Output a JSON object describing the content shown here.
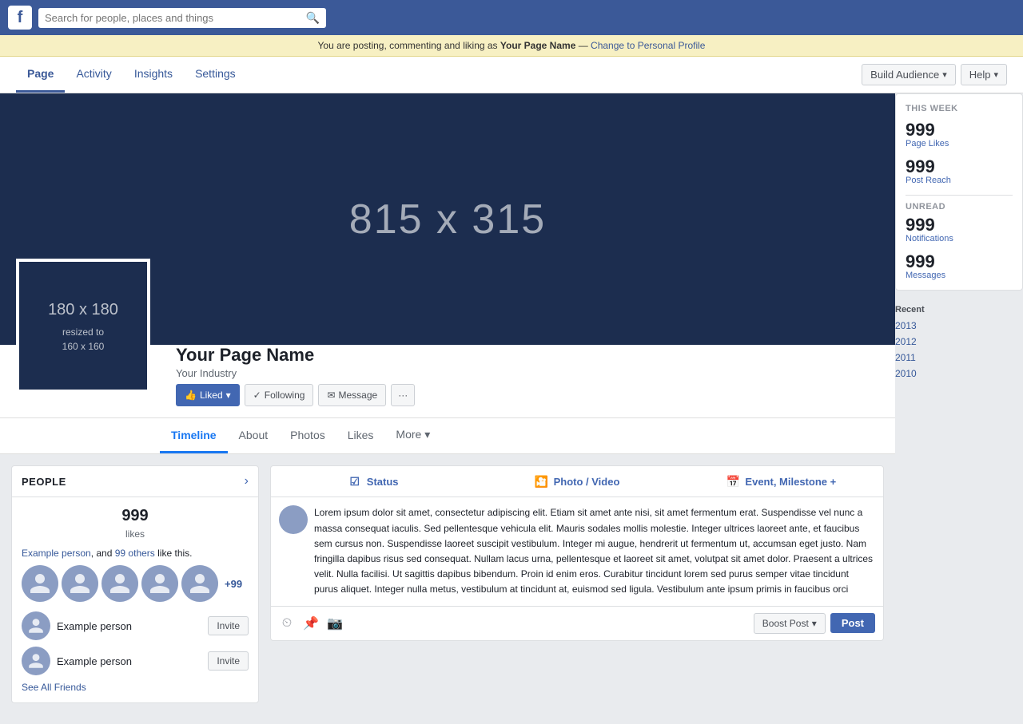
{
  "topnav": {
    "logo": "f",
    "search_placeholder": "Search for people, places and things"
  },
  "banner": {
    "text_before": "You are posting, commenting and liking as ",
    "page_name": "Your Page Name",
    "text_after": " — ",
    "link": "Change to Personal Profile"
  },
  "pagenav": {
    "tabs": [
      {
        "label": "Page",
        "active": true
      },
      {
        "label": "Activity",
        "active": false
      },
      {
        "label": "Insights",
        "active": false
      },
      {
        "label": "Settings",
        "active": false
      }
    ],
    "build_audience": "Build Audience",
    "help": "Help"
  },
  "cover": {
    "dimensions": "815 x 315"
  },
  "profile": {
    "pic_main": "180 x 180",
    "pic_sub": "resized to",
    "pic_sub2": "160 x 160",
    "name": "Your Page Name",
    "industry": "Your Industry",
    "actions": {
      "liked": "Liked",
      "following": "Following",
      "message": "Message",
      "more": "···"
    }
  },
  "timeline_tabs": [
    {
      "label": "Timeline",
      "active": true
    },
    {
      "label": "About",
      "active": false
    },
    {
      "label": "Photos",
      "active": false
    },
    {
      "label": "Likes",
      "active": false
    },
    {
      "label": "More",
      "active": false
    }
  ],
  "people_card": {
    "title": "PEOPLE",
    "likes_count": "999",
    "likes_label": "likes",
    "like_text_friend": "Example person",
    "like_text_others": "99 others",
    "like_text_suffix": "like this.",
    "more_count": "+99",
    "invite_people": [
      {
        "name": "Example person"
      },
      {
        "name": "Example person"
      }
    ],
    "see_all": "See All Friends"
  },
  "post_composer": {
    "tabs": [
      {
        "icon": "✔",
        "icon_color": "#4267b2",
        "label": "Status"
      },
      {
        "icon": "🎞",
        "label": "Photo / Video"
      },
      {
        "icon": "📅",
        "label": "Event, Milestone +"
      }
    ],
    "post_text": "Lorem ipsum dolor sit amet, consectetur adipiscing elit. Etiam sit amet ante nisi, sit amet fermentum erat. Suspendisse vel nunc a massa consequat iaculis. Sed pellentesque vehicula elit. Mauris sodales mollis molestie. Integer ultrices laoreet ante, et faucibus sem cursus non. Suspendisse laoreet suscipit vestibulum. Integer mi augue, hendrerit ut fermentum ut, accumsan eget justo. Nam fringilla dapibus risus sed consequat. Nullam lacus urna, pellentesque et laoreet sit amet, volutpat sit amet dolor. Praesent a ultrices velit. Nulla facilisi. Ut sagittis dapibus bibendum. Proin id enim eros. Curabitur tincidunt lorem sed purus semper vitae tincidunt purus aliquet. Integer nulla metus, vestibulum at tincidunt at, euismod sed ligula. Vestibulum ante ipsum primis in faucibus orci",
    "boost_label": "Boost Post",
    "post_label": "Post"
  },
  "right_widget": {
    "this_week": "THIS WEEK",
    "page_likes_count": "999",
    "page_likes_label": "Page Likes",
    "post_reach_count": "999",
    "post_reach_label": "Post Reach",
    "unread": "UNREAD",
    "notifications_count": "999",
    "notifications_label": "Notifications",
    "messages_count": "999",
    "messages_label": "Messages"
  },
  "recent": {
    "title": "Recent",
    "years": [
      "2013",
      "2012",
      "2011",
      "2010"
    ]
  }
}
